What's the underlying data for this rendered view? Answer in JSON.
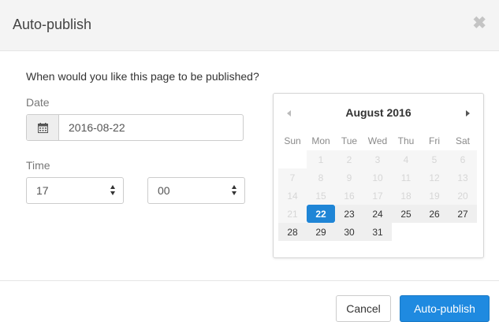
{
  "dialog": {
    "title": "Auto-publish",
    "close_icon": "close-icon",
    "question": "When would you like this page to be published?"
  },
  "date": {
    "label": "Date",
    "value": "2016-08-22",
    "icon": "calendar-icon"
  },
  "time": {
    "label": "Time",
    "hour": "17",
    "minute": "00"
  },
  "calendar": {
    "month_label": "August 2016",
    "weekdays": [
      "Sun",
      "Mon",
      "Tue",
      "Wed",
      "Thu",
      "Fri",
      "Sat"
    ],
    "weeks": [
      [
        "",
        "1",
        "2",
        "3",
        "4",
        "5",
        "6"
      ],
      [
        "7",
        "8",
        "9",
        "10",
        "11",
        "12",
        "13"
      ],
      [
        "14",
        "15",
        "16",
        "17",
        "18",
        "19",
        "20"
      ],
      [
        "21",
        "22",
        "23",
        "24",
        "25",
        "26",
        "27"
      ],
      [
        "28",
        "29",
        "30",
        "31",
        "",
        "",
        ""
      ]
    ],
    "selected_day": "22",
    "first_enabled_day": "22",
    "colors": {
      "selected": "#1f85d6",
      "enabled_text": "#333333",
      "disabled_text": "#d6d6d6"
    }
  },
  "footer": {
    "cancel_label": "Cancel",
    "publish_label": "Auto-publish"
  }
}
